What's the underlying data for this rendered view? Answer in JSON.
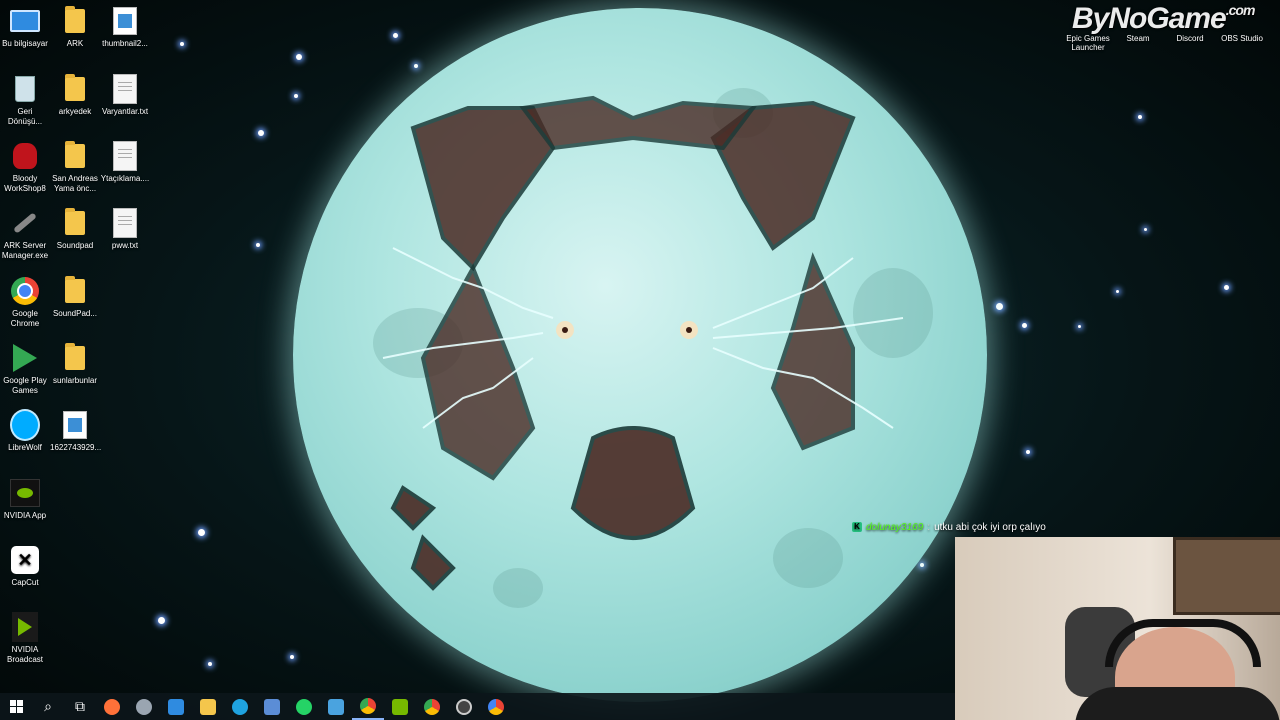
{
  "desktop": {
    "icons_col1": [
      {
        "label": "Bu bilgisayar",
        "icon": "computer-icon"
      },
      {
        "label": "Geri Dönüşü...",
        "icon": "recycle-bin-icon"
      },
      {
        "label": "Bloody WorkShop8",
        "icon": "bloody-hand-icon"
      },
      {
        "label": "ARK Server Manager.exe",
        "icon": "wrench-icon"
      },
      {
        "label": "Google Chrome",
        "icon": "chrome-icon"
      },
      {
        "label": "Google Play Games",
        "icon": "play-games-icon"
      },
      {
        "label": "LibreWolf",
        "icon": "librewolf-icon"
      },
      {
        "label": "NVIDIA App",
        "icon": "nvidia-icon"
      },
      {
        "label": "CapCut",
        "icon": "capcut-icon"
      },
      {
        "label": "NVIDIA Broadcast",
        "icon": "nvidia-broadcast-icon"
      }
    ],
    "icons_col2": [
      {
        "label": "ARK",
        "icon": "folder-icon"
      },
      {
        "label": "arkyedek",
        "icon": "folder-icon"
      },
      {
        "label": "San Andreas Yama önc...",
        "icon": "folder-icon"
      },
      {
        "label": "Soundpad",
        "icon": "folder-icon"
      },
      {
        "label": "SoundPad...",
        "icon": "folder-icon"
      },
      {
        "label": "sunlarbunlar",
        "icon": "folder-icon"
      },
      {
        "label": "1622743929...",
        "icon": "image-file-icon"
      }
    ],
    "icons_col3": [
      {
        "label": "thumbnail2...",
        "icon": "image-file-icon"
      },
      {
        "label": "Varyantlar.txt",
        "icon": "text-file-icon"
      },
      {
        "label": "Ytaçıklama....",
        "icon": "text-file-icon"
      },
      {
        "label": "pww.txt",
        "icon": "text-file-icon"
      }
    ],
    "top_right_icons": [
      {
        "label": "Epic Games Launcher",
        "icon": "epic-games-icon"
      },
      {
        "label": "Steam",
        "icon": "steam-icon"
      },
      {
        "label": "Discord",
        "icon": "discord-icon"
      },
      {
        "label": "OBS Studio",
        "icon": "obs-icon"
      }
    ]
  },
  "overlay": {
    "watermark": "ByNoGame",
    "watermark_suffix": ".com",
    "chat_user": "dolunay3169",
    "chat_message": "utku abi çok iyi orp çalıyo"
  },
  "taskbar": {
    "start": "start-icon",
    "search": "search-icon",
    "task_view": "task-view-icon",
    "apps": [
      {
        "name": "firefox-icon",
        "color": "#ff7139"
      },
      {
        "name": "app-icon",
        "color": "#9aa5b1"
      },
      {
        "name": "store-icon",
        "color": "#2f8be0"
      },
      {
        "name": "file-explorer-icon",
        "color": "#f4c64c"
      },
      {
        "name": "edge-icon",
        "color": "#1fa3e0"
      },
      {
        "name": "monitor-icon",
        "color": "#5b8dd6"
      },
      {
        "name": "whatsapp-icon",
        "color": "#25d366"
      },
      {
        "name": "window-icon",
        "color": "#4aa3df"
      },
      {
        "name": "chrome-icon",
        "color": "#ea4335"
      },
      {
        "name": "nvidia-broadcast-icon",
        "color": "#76b900"
      },
      {
        "name": "chrome-icon",
        "color": "#34a853"
      },
      {
        "name": "obs-icon",
        "color": "#444"
      },
      {
        "name": "chrome-icon",
        "color": "#4285f4"
      }
    ]
  }
}
